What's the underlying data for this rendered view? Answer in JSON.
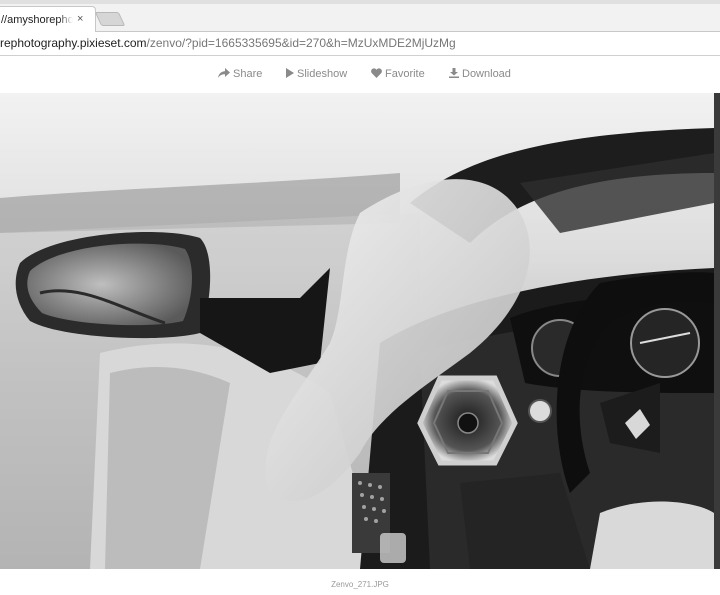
{
  "browser": {
    "tab_title": "//amyshorephotog",
    "tab_close": "×",
    "url_host": "rephotography.pixieset.com",
    "url_path": "/zenvo/?pid=1665335695&id=270&h=MzUxMDE2MjUzMg"
  },
  "toolbar": {
    "share_label": "Share",
    "slideshow_label": "Slideshow",
    "favorite_label": "Favorite",
    "download_label": "Download"
  },
  "photo": {
    "caption": "Zenvo_271.JPG"
  },
  "colors": {
    "toolbar_text": "#8a8a8a",
    "url_host": "#222222",
    "url_path": "#777777"
  }
}
